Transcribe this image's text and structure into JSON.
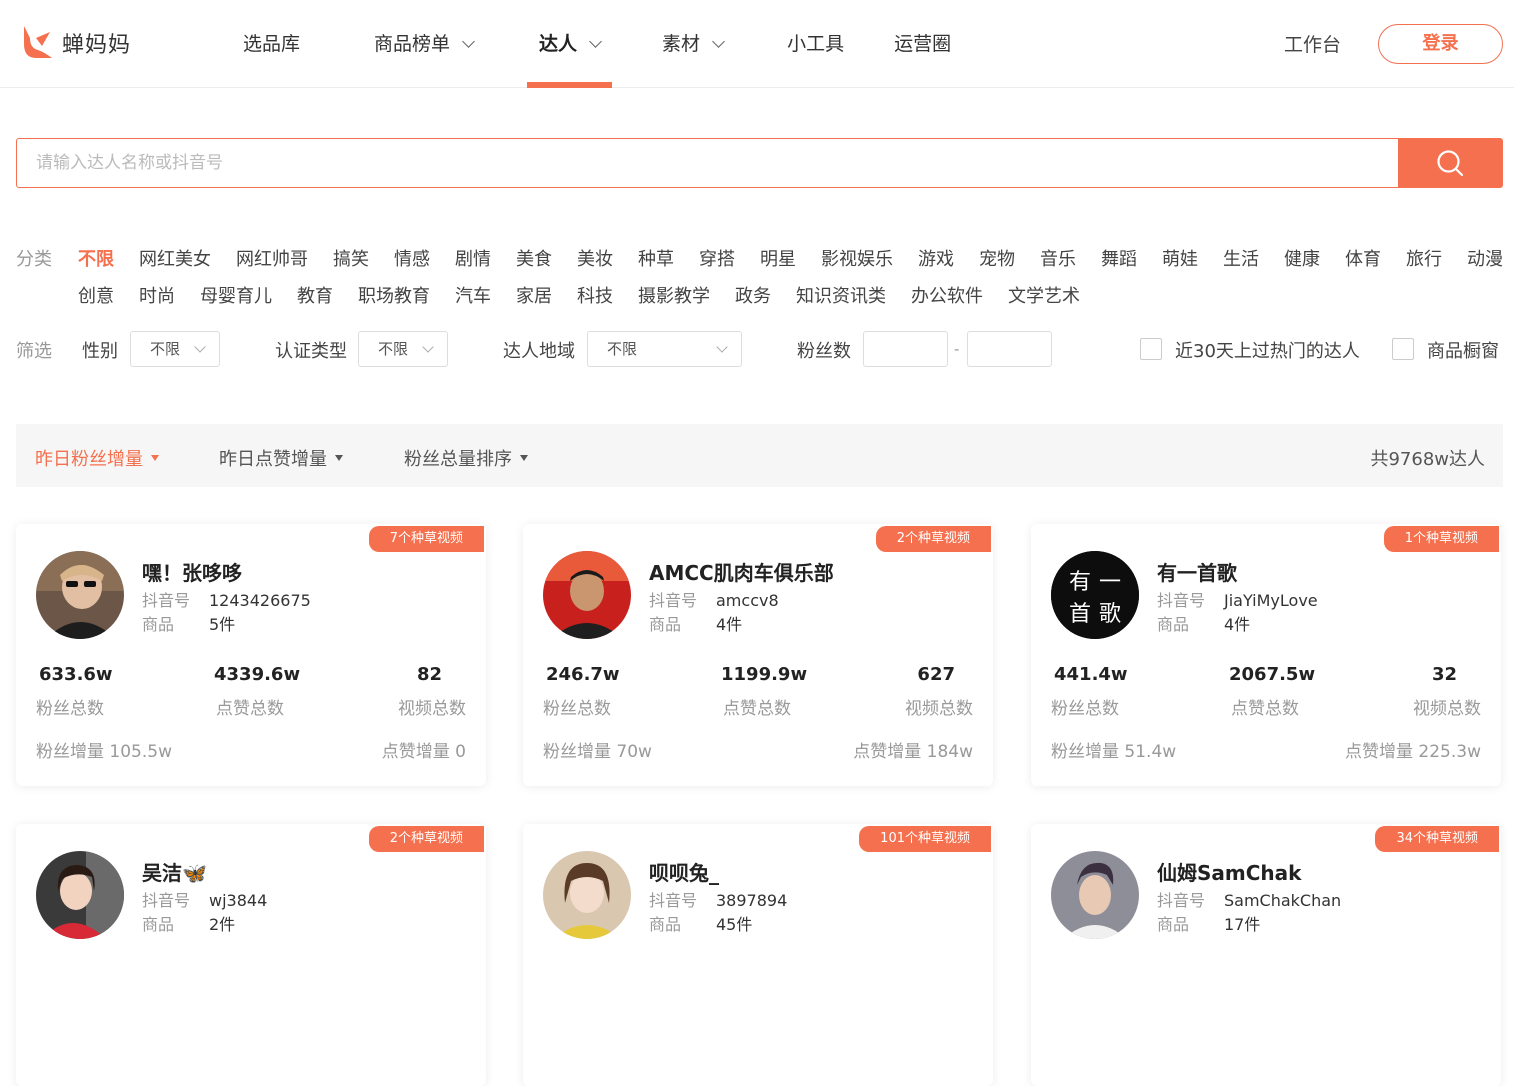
{
  "brand": {
    "name": "蝉妈妈",
    "accent": "#f5704e"
  },
  "nav": {
    "items": [
      {
        "label": "选品库",
        "dropdown": false,
        "active": false
      },
      {
        "label": "商品榜单",
        "dropdown": true,
        "active": false
      },
      {
        "label": "达人",
        "dropdown": true,
        "active": true
      },
      {
        "label": "素材",
        "dropdown": true,
        "active": false
      },
      {
        "label": "小工具",
        "dropdown": false,
        "active": false
      },
      {
        "label": "运营圈",
        "dropdown": false,
        "active": false
      }
    ],
    "workbench": "工作台",
    "login": "登录"
  },
  "search": {
    "placeholder": "请输入达人名称或抖音号",
    "value": "",
    "icon": "search-icon"
  },
  "categories": {
    "label": "分类",
    "row1": [
      "不限",
      "网红美女",
      "网红帅哥",
      "搞笑",
      "情感",
      "剧情",
      "美食",
      "美妆",
      "种草",
      "穿搭",
      "明星",
      "影视娱乐",
      "游戏",
      "宠物",
      "音乐",
      "舞蹈",
      "萌娃",
      "生活",
      "健康",
      "体育",
      "旅行",
      "动漫"
    ],
    "row2": [
      "创意",
      "时尚",
      "母婴育儿",
      "教育",
      "职场教育",
      "汽车",
      "家居",
      "科技",
      "摄影教学",
      "政务",
      "知识资讯类",
      "办公软件",
      "文学艺术"
    ],
    "selected": "不限"
  },
  "filters": {
    "label": "筛选",
    "gender_label": "性别",
    "gender_value": "不限",
    "cert_label": "认证类型",
    "cert_value": "不限",
    "region_label": "达人地域",
    "region_value": "不限",
    "fans_label": "粉丝数",
    "fans_sep": "-",
    "hot_label": "近30天上过热门的达人",
    "window_label": "商品橱窗"
  },
  "sort": {
    "options": [
      "昨日粉丝增量",
      "昨日点赞增量",
      "粉丝总量排序"
    ],
    "active": "昨日粉丝增量",
    "total": "共9768w达人"
  },
  "labels": {
    "douyin": "抖音号",
    "goods": "商品",
    "fans_total": "粉丝总数",
    "likes_total": "点赞总数",
    "videos_total": "视频总数",
    "fans_inc": "粉丝增量",
    "likes_inc": "点赞增量"
  },
  "cards": [
    {
      "badge": "7个种草视频",
      "name": "嘿！张哆哆",
      "douyin_id": "1243426675",
      "goods": "5件",
      "fans": "633.6w",
      "likes": "4339.6w",
      "videos": "82",
      "fans_inc": "105.5w",
      "likes_inc": "0"
    },
    {
      "badge": "2个种草视频",
      "name": "AMCC肌肉车俱乐部",
      "douyin_id": "amccv8",
      "goods": "4件",
      "fans": "246.7w",
      "likes": "1199.9w",
      "videos": "627",
      "fans_inc": "70w",
      "likes_inc": "184w"
    },
    {
      "badge": "1个种草视频",
      "name": "有一首歌",
      "douyin_id": "JiaYiMyLove",
      "goods": "4件",
      "fans": "441.4w",
      "likes": "2067.5w",
      "videos": "32",
      "fans_inc": "51.4w",
      "likes_inc": "225.3w",
      "avatar_text": [
        "有",
        "一",
        "首",
        "歌"
      ]
    },
    {
      "badge": "2个种草视频",
      "name": "吴洁🦋",
      "douyin_id": "wj3844",
      "goods": "2件"
    },
    {
      "badge": "101个种草视频",
      "name": "呗呗兔_",
      "douyin_id": "3897894",
      "goods": "45件"
    },
    {
      "badge": "34个种草视频",
      "name": "仙姆SamChak",
      "douyin_id": "SamChakChan",
      "goods": "17件"
    }
  ]
}
